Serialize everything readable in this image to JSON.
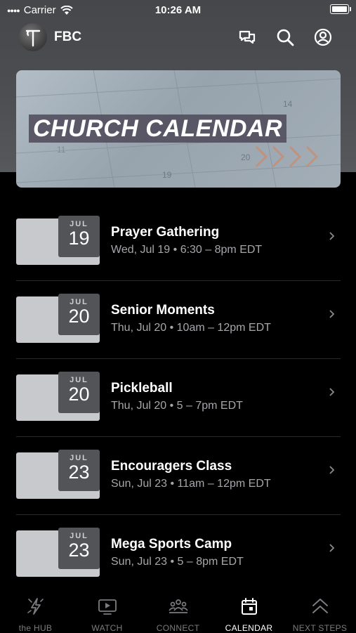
{
  "status_bar": {
    "carrier": "Carrier",
    "time": "10:26 AM"
  },
  "app_bar": {
    "name": "FBC"
  },
  "banner": {
    "title": "CHURCH CALENDAR"
  },
  "events": [
    {
      "month": "JUL",
      "day": "19",
      "title": "Prayer Gathering",
      "subtitle": "Wed, Jul 19 • 6:30 – 8pm EDT"
    },
    {
      "month": "JUL",
      "day": "20",
      "title": "Senior Moments",
      "subtitle": "Thu, Jul 20 • 10am – 12pm EDT"
    },
    {
      "month": "JUL",
      "day": "20",
      "title": "Pickleball",
      "subtitle": "Thu, Jul 20 • 5 – 7pm EDT"
    },
    {
      "month": "JUL",
      "day": "23",
      "title": "Encouragers Class",
      "subtitle": "Sun, Jul 23 • 11am – 12pm EDT"
    },
    {
      "month": "JUL",
      "day": "23",
      "title": "Mega Sports Camp",
      "subtitle": "Sun, Jul 23 • 5 – 8pm EDT"
    }
  ],
  "tabs": [
    {
      "label": "the HUB",
      "icon": "hub-icon",
      "active": false
    },
    {
      "label": "WATCH",
      "icon": "tv-play-icon",
      "active": false
    },
    {
      "label": "CONNECT",
      "icon": "group-icon",
      "active": false
    },
    {
      "label": "CALENDAR",
      "icon": "calendar-icon",
      "active": true
    },
    {
      "label": "NEXT STEPS",
      "icon": "double-chevron-up-icon",
      "active": false
    }
  ],
  "colors": {
    "background": "#000000",
    "header": "#4d4e52",
    "accent": "#ffffff",
    "muted": "#7b7c80",
    "chevron_accent": "#c98b6e"
  }
}
